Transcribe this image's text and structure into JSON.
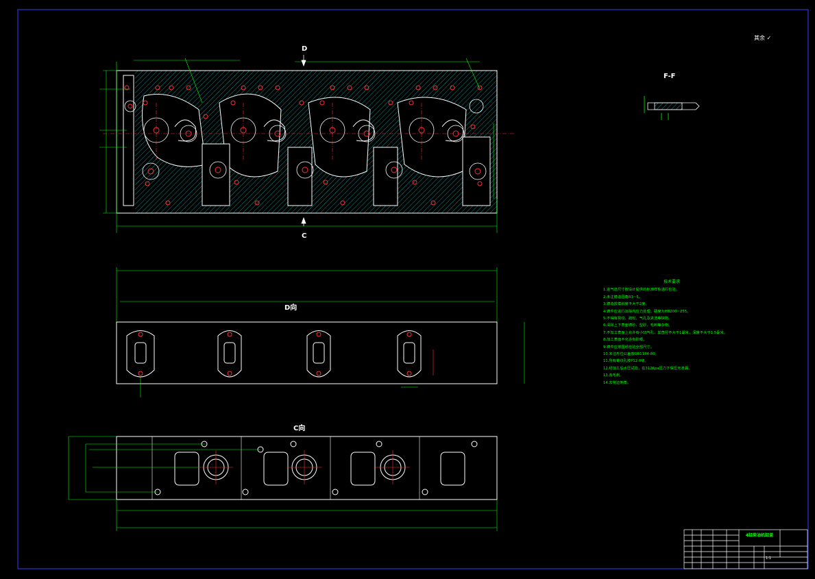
{
  "drawing": {
    "section_label": "F-F",
    "view_d_marker": "D",
    "view_c_marker": "C",
    "view_d_title": "D向",
    "view_c_title": "C向",
    "roughness_note": "其余",
    "tech_title": "技术要求",
    "tech_notes": [
      "1.进气道尺寸按设计提供的标准样板进行检验。",
      "2.未注铸造圆角R3~5。",
      "3.铸造拔模斜度不大于2度。",
      "4.铸件应进行消除内应力处理，硬度为HB200~255。",
      "5.不得有裂纹、疏松、气孔及夹渣等缺陷。",
      "6.清除上下表面铸砂、型砂、毛刺等杂物。",
      "7.不加工表面上允许有小凹气孔，其直径不大于1毫米，深度不大于1.5毫米。",
      "8.加工表面不允许有砂眼。",
      "9.铸件应按图纸检验全部尺寸。",
      "10.未注形位公差按GB1184-80。",
      "11.所有螺纹孔按P12.0级。",
      "12.经加工后水压试验，在312Kpa压力下保压无渗漏。",
      "13.去毛刺。",
      "14.去锐边倒角。"
    ],
    "title_block": {
      "name": "4缸柴油机缸盖",
      "scale": "1:1"
    }
  }
}
